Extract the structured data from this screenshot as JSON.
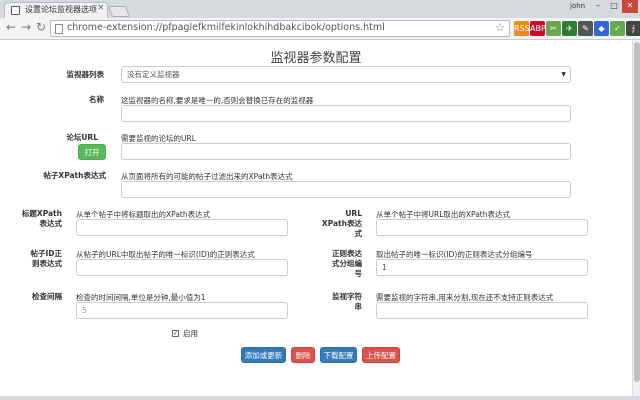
{
  "browser": {
    "tab_title": "设置论坛监视器选项",
    "tab_close": "×",
    "user_name": "john",
    "url": "chrome-extension://pfpaglefkmilfekinlokhihdbakcibok/options.html",
    "win_min": "–",
    "win_max": "□",
    "win_close": "✕",
    "back": "←",
    "forward": "→",
    "reload": "↻",
    "star": "☆",
    "menu": "≡",
    "extensions": [
      {
        "name": "rss-ext",
        "color": "#e98a15",
        "glyph": "RSS"
      },
      {
        "name": "abp-ext",
        "color": "#c70d2c",
        "glyph": "ABP"
      },
      {
        "name": "clip-ext",
        "color": "#6aa84f",
        "glyph": "✂"
      },
      {
        "name": "bird-ext",
        "color": "#2e7d32",
        "glyph": "✈"
      },
      {
        "name": "pen-ext",
        "color": "#555555",
        "glyph": "✎"
      },
      {
        "name": "cube-ext",
        "color": "#3367d6",
        "glyph": "◆"
      },
      {
        "name": "leaf-ext",
        "color": "#6aa84f",
        "glyph": "✓"
      },
      {
        "name": "gear-ext",
        "color": "#444444",
        "glyph": "∮"
      }
    ]
  },
  "page": {
    "title": "监视器参数配置",
    "monitor_list": {
      "label": "监视器列表",
      "selected": "没有定义监视器",
      "caret": "▼"
    },
    "name": {
      "label": "名称",
      "help": "这监视器的名称,要求是唯一的,否则会替换已存在的监视器",
      "value": ""
    },
    "forum_url": {
      "label": "论坛URL",
      "help": "需要监视的论坛的URL",
      "open_button": "打开",
      "value": ""
    },
    "post_xpath": {
      "label": "帖子XPath表达式",
      "help": "从页面将所有的可能的帖子过滤出来的XPath表达式",
      "value": ""
    },
    "title_xpath": {
      "label_line1": "标题XPath",
      "label_line2": "表达式",
      "help": "从单个帖子中将标题取出的XPath表达式",
      "value": ""
    },
    "url_xpath": {
      "label_line1": "URL",
      "label_line2": "XPath表达",
      "label_line3": "式",
      "help": "从单个帖子中将URL取出的XPath表达式",
      "value": ""
    },
    "post_id_regex": {
      "label_line1": "帖子ID正",
      "label_line2": "则表达式",
      "help": "从帖子的URL中取出帖子的唯一标识(ID)的正则表达式",
      "value": ""
    },
    "regex_group": {
      "label_line1": "正则表达",
      "label_line2": "式分组编",
      "label_line3": "号",
      "help": "取出帖子的唯一标识(ID)的正则表达式分组编号",
      "value": "1"
    },
    "check_interval": {
      "label": "检查间隔",
      "help": "检查的时间间隔,单位是分钟,最小值为1",
      "placeholder": "5"
    },
    "keywords": {
      "label_line1": "监视字符",
      "label_line2": "串",
      "help": "需要监视的字符串,用来分割,现在还不支持正则表达式",
      "value": ""
    },
    "enabled": {
      "label": "启用",
      "checked_mark": "✓"
    },
    "buttons": {
      "add_update": "添加或更新",
      "delete": "删除",
      "download": "下载配置",
      "upload": "上传配置"
    }
  }
}
